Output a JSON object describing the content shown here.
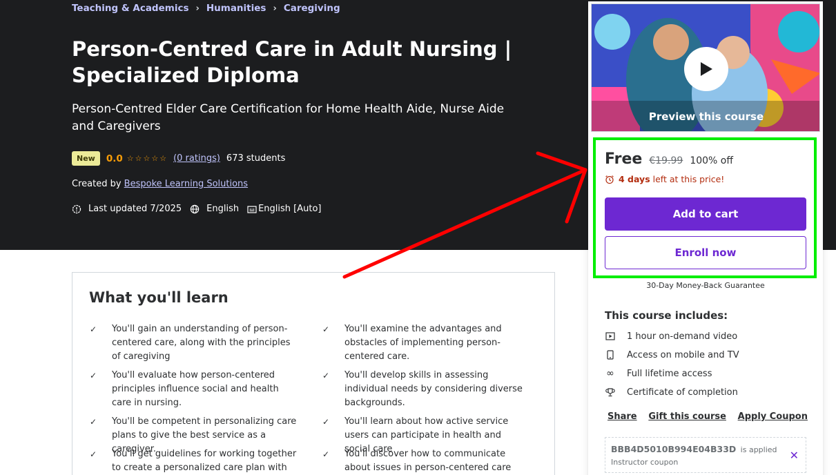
{
  "breadcrumb": [
    "Teaching & Academics",
    "Humanities",
    "Caregiving"
  ],
  "course": {
    "title": "Person-Centred Care in Adult Nursing | Specialized Diploma",
    "subtitle": "Person-Centred Elder Care Certification for Home Health Aide, Nurse Aide and Caregivers",
    "badge": "New",
    "rating": "0.0",
    "ratings_link": "(0 ratings)",
    "students": "673 students",
    "created_by_label": "Created by",
    "instructor": "Bespoke Learning Solutions",
    "last_updated": "Last updated 7/2025",
    "language": "English",
    "captions": "English [Auto]"
  },
  "learn": {
    "heading": "What you'll learn",
    "items": [
      "You'll gain an understanding of person-centered care, along with the principles of caregiving",
      "You'll examine the advantages and obstacles of implementing person-centered care.",
      "You'll evaluate how person-centered principles influence social and health care in nursing.",
      "You'll develop skills in assessing individual needs by considering diverse backgrounds.",
      "You'll be competent in personalizing care plans to give the best service as a caregiver.",
      "You'll learn about how active service users can participate in health and social care",
      "You'll get guidelines for working together to create a personalized care plan with",
      "You'll discover how to communicate about issues in person-centered care properly."
    ]
  },
  "sidebar": {
    "preview_label": "Preview this course",
    "price": "Free",
    "original_price": "€19.99",
    "discount": "100% off",
    "timer_bold": "4 days",
    "timer_rest": "left at this price!",
    "add_to_cart": "Add to cart",
    "enroll_now": "Enroll now",
    "guarantee": "30-Day Money-Back Guarantee",
    "includes_title": "This course includes:",
    "includes": [
      {
        "icon": "video-icon",
        "text": "1 hour on-demand video"
      },
      {
        "icon": "mobile-icon",
        "text": "Access on mobile and TV"
      },
      {
        "icon": "infinity-icon",
        "text": "Full lifetime access"
      },
      {
        "icon": "trophy-icon",
        "text": "Certificate of completion"
      }
    ],
    "links": {
      "share": "Share",
      "gift": "Gift this course",
      "coupon": "Apply Coupon"
    },
    "coupon_code": "BBB4D5010B994E04B33D",
    "coupon_applied": "is applied",
    "coupon_label": "Instructor coupon"
  },
  "colors": {
    "hero_bg": "#1c1d1f",
    "accent_purple": "#6d28d2",
    "link_lavender": "#c0c4fc",
    "star_orange": "#f69c08",
    "timer_red": "#b32d0f",
    "highlight_green": "#00ee00",
    "annotation_arrow": "#ff0000"
  }
}
